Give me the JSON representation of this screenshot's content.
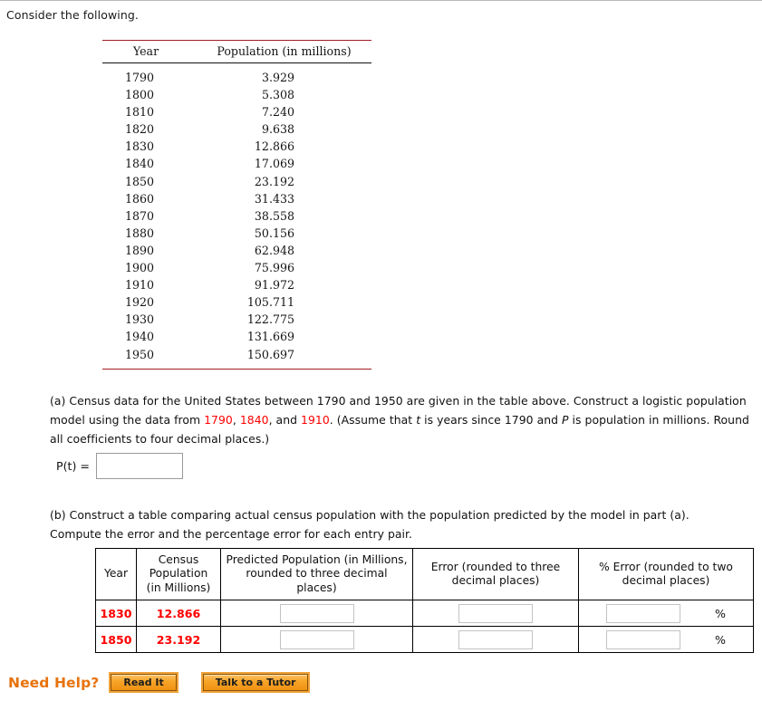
{
  "page": {
    "prompt": "Consider the following."
  },
  "census_table": {
    "headers": [
      "Year",
      "Population (in millions)"
    ],
    "rows": [
      [
        "1790",
        "3.929"
      ],
      [
        "1800",
        "5.308"
      ],
      [
        "1810",
        "7.240"
      ],
      [
        "1820",
        "9.638"
      ],
      [
        "1830",
        "12.866"
      ],
      [
        "1840",
        "17.069"
      ],
      [
        "1850",
        "23.192"
      ],
      [
        "1860",
        "31.433"
      ],
      [
        "1870",
        "38.558"
      ],
      [
        "1880",
        "50.156"
      ],
      [
        "1890",
        "62.948"
      ],
      [
        "1900",
        "75.996"
      ],
      [
        "1910",
        "91.972"
      ],
      [
        "1920",
        "105.711"
      ],
      [
        "1930",
        "122.775"
      ],
      [
        "1940",
        "131.669"
      ],
      [
        "1950",
        "150.697"
      ]
    ]
  },
  "part_a": {
    "text_1": "(a) Census data for the United States between 1790 and 1950 are given in the table above. Construct a logistic population model using the data from ",
    "year_1": "1790",
    "sep_1": ", ",
    "year_2": "1840",
    "sep_2": ", and ",
    "year_3": "1910",
    "text_2": ". (Assume that ",
    "var_t": "t",
    "text_3": " is years since 1790 and ",
    "var_p": "P",
    "text_4": " is population in millions. Round all coefficients to four decimal places.)",
    "answer_label": "P(t) =",
    "answer_value": ""
  },
  "part_b": {
    "text": "(b) Construct a table comparing actual census population with the population predicted by the model in part (a). Compute the error and the percentage error for each entry pair.",
    "headers": {
      "year": "Year",
      "census_population": "Census Population (in Millions)",
      "predicted_population": "Predicted Population (in Millions, rounded to three decimal places)",
      "error": "Error (rounded to three decimal places)",
      "percent_error": "% Error (rounded to two decimal places)"
    },
    "rows": [
      {
        "year": "1830",
        "census_population": "12.866",
        "predicted_population": "",
        "error": "",
        "percent_error": "",
        "percent_sign": "%"
      },
      {
        "year": "1850",
        "census_population": "23.192",
        "predicted_population": "",
        "error": "",
        "percent_error": "",
        "percent_sign": "%"
      }
    ]
  },
  "footer": {
    "label": "Need Help?",
    "read_it": "Read It",
    "talk_to_tutor": "Talk to a Tutor"
  },
  "colors": {
    "highlight_red": "#ff0000",
    "table_rule_red": "#a31b20",
    "help_orange": "#e8720c"
  }
}
